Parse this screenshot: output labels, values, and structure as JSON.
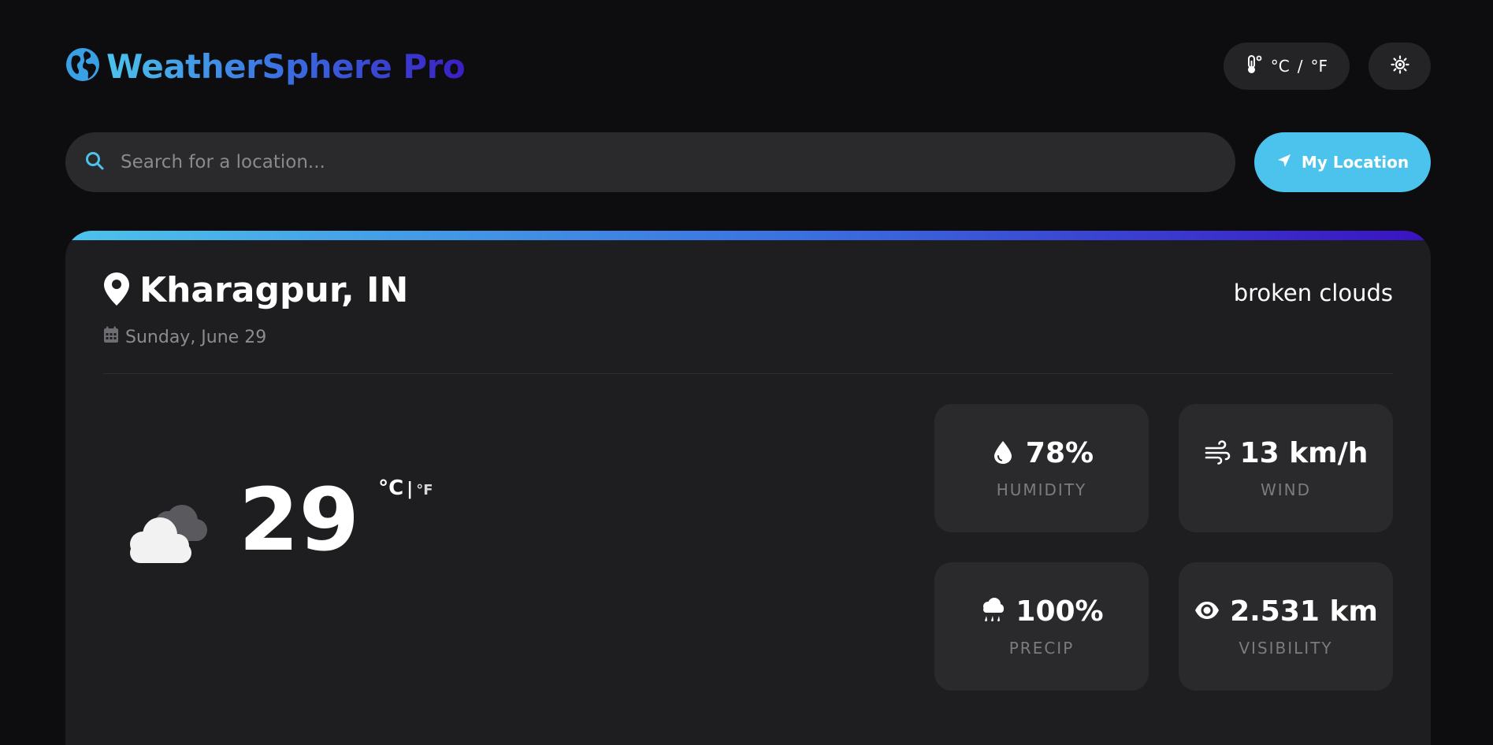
{
  "app": {
    "title": "WeatherSphere Pro"
  },
  "header": {
    "unit_toggle": {
      "celsius": "°C",
      "separator": "/",
      "fahrenheit": "°F"
    }
  },
  "search": {
    "placeholder": "Search for a location...",
    "value": "",
    "location_button_label": "My Location"
  },
  "weather": {
    "city": "Kharagpur, IN",
    "condition": "broken clouds",
    "date": "Sunday, June 29",
    "temperature": "29",
    "unit_celsius": "°C",
    "unit_separator": "|",
    "unit_fahrenheit": "°F",
    "stats": [
      {
        "icon": "droplet-icon",
        "value": "78%",
        "label": "HUMIDITY"
      },
      {
        "icon": "wind-icon",
        "value": "13 km/h",
        "label": "WIND"
      },
      {
        "icon": "cloud-rain-icon",
        "value": "100%",
        "label": "PRECIP"
      },
      {
        "icon": "eye-icon",
        "value": "2.531 km",
        "label": "VISIBILITY"
      }
    ]
  },
  "colors": {
    "background": "#0d0d0f",
    "card": "#1e1e20",
    "accent": "#4cc3ec",
    "accent_end": "#3a12c2"
  }
}
